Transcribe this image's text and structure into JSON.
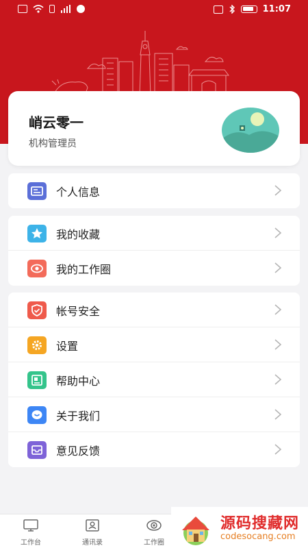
{
  "status_bar": {
    "time": "11:07"
  },
  "profile": {
    "name": "峭云零一",
    "role": "机构管理员"
  },
  "groups": [
    {
      "items": [
        {
          "label": "个人信息",
          "icon": "id-card-icon",
          "color": "#5b6fd8"
        }
      ]
    },
    {
      "items": [
        {
          "label": "我的收藏",
          "icon": "star-icon",
          "color": "#3db3e8"
        },
        {
          "label": "我的工作圈",
          "icon": "eye-icon",
          "color": "#f36b5a"
        }
      ]
    },
    {
      "items": [
        {
          "label": "帐号安全",
          "icon": "shield-icon",
          "color": "#ef5a4b"
        },
        {
          "label": "设置",
          "icon": "gear-icon",
          "color": "#f5a623"
        },
        {
          "label": "帮助中心",
          "icon": "help-book-icon",
          "color": "#34c48b"
        },
        {
          "label": "关于我们",
          "icon": "chat-bubble-icon",
          "color": "#3d86f5"
        },
        {
          "label": "意见反馈",
          "icon": "inbox-icon",
          "color": "#7e63d8"
        }
      ]
    }
  ],
  "tabs": [
    {
      "label": "工作台",
      "icon": "desktop-icon"
    },
    {
      "label": "通讯录",
      "icon": "contacts-icon"
    },
    {
      "label": "工作圈",
      "icon": "eye-icon"
    }
  ],
  "watermark": {
    "title": "源码搜藏网",
    "domain": "codesocang.com"
  },
  "colors": {
    "brand_red": "#c8161d",
    "page_bg": "#f3f3f5"
  }
}
